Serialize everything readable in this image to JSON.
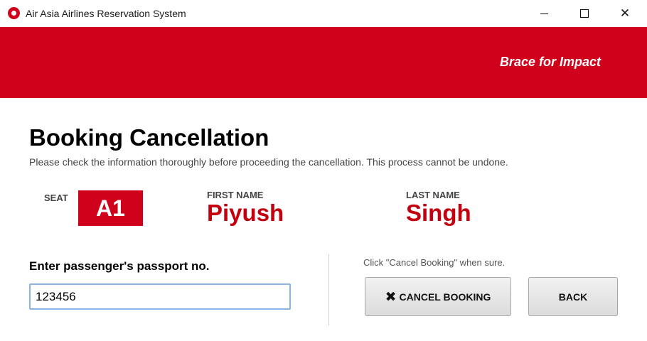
{
  "window": {
    "title": "Air Asia Airlines Reservation System"
  },
  "banner": {
    "tagline": "Brace for Impact"
  },
  "page": {
    "title": "Booking Cancellation",
    "subtitle": "Please check the information thoroughly before proceeding the cancellation. This process cannot be undone."
  },
  "booking": {
    "seat_label": "SEAT",
    "seat_value": "A1",
    "first_name_label": "FIRST NAME",
    "first_name_value": "Piyush",
    "last_name_label": "LAST NAME",
    "last_name_value": "Singh"
  },
  "passport": {
    "label": "Enter passenger's passport no.",
    "value": "123456"
  },
  "actions": {
    "hint": "Click \"Cancel Booking\" when sure.",
    "cancel_icon": "x-icon",
    "cancel_label": "CANCEL BOOKING",
    "back_label": "BACK"
  },
  "colors": {
    "brand": "#d0021b",
    "name_text": "#c4000f"
  }
}
